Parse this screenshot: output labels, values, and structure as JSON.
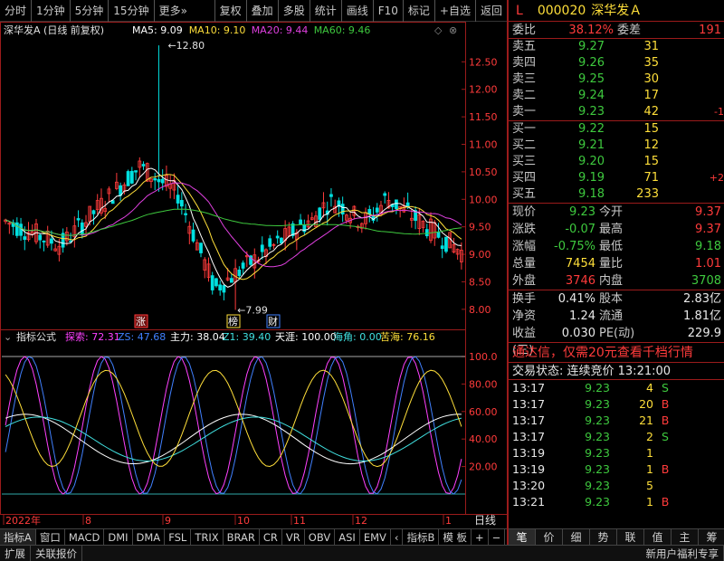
{
  "toolbar": {
    "left_items": [
      "分时",
      "1分钟",
      "5分钟",
      "15分钟",
      "更多»"
    ],
    "right_items": [
      "复权",
      "叠加",
      "多股",
      "统计",
      "画线",
      "F10",
      "标记",
      "+自选",
      "返回"
    ]
  },
  "chart": {
    "title": "深华发A (日线 前复权)",
    "ma": [
      {
        "label": "MA5: 9.09",
        "color": "#ffffff"
      },
      {
        "label": "MA10: 9.10",
        "color": "#ffdf3a"
      },
      {
        "label": "MA20: 9.44",
        "color": "#e040e0"
      },
      {
        "label": "MA60: 9.46",
        "color": "#3ec93e"
      }
    ],
    "price_axis": [
      "12.50",
      "12.00",
      "11.50",
      "11.00",
      "10.50",
      "10.00",
      "9.50",
      "9.00",
      "8.50",
      "8.00"
    ],
    "high_mark": "12.80",
    "low_mark": "7.99",
    "event_markers": [
      "涨",
      "榜",
      "财"
    ],
    "indicator": {
      "name": "指标公式",
      "values": [
        {
          "label": "探索: 72.31",
          "color": "#ff40ff"
        },
        {
          "label": "ZS: 47.68",
          "color": "#4080ff"
        },
        {
          "label": "主力: 38.04",
          "color": "#ffffff"
        },
        {
          "label": "Z1: 39.40",
          "color": "#40e0e0"
        },
        {
          "label": "天涯: 100.00",
          "color": "#ffffff"
        },
        {
          "label": "海角: 0.00",
          "color": "#40e0e0"
        },
        {
          "label": "苦海: 76.16",
          "color": "#ffdf3a"
        }
      ],
      "axis": [
        "100.0",
        "80.00",
        "60.00",
        "40.00",
        "20.00"
      ]
    },
    "date_axis": [
      "2022年",
      "8",
      "9",
      "10",
      "11",
      "12",
      "1"
    ],
    "period": "日线"
  },
  "bottom_tabs": [
    "指标A",
    "窗口",
    "MACD",
    "DMI",
    "DMA",
    "FSL",
    "TRIX",
    "BRAR",
    "CR",
    "VR",
    "OBV",
    "ASI",
    "EMV",
    "‹",
    "指标B",
    "模 板",
    "+",
    "−"
  ],
  "statusbar": {
    "left": [
      "扩展",
      "关联报价"
    ],
    "promo": "新用户福利专享"
  },
  "panel": {
    "marker": "L",
    "code": "000020",
    "name": "深华发Ａ",
    "weibi_label": "委比",
    "weibi": "38.12%",
    "weicha_label": "委差",
    "weicha": "191",
    "sells": [
      {
        "label": "卖五",
        "price": "9.27",
        "vol": "31",
        "chg": ""
      },
      {
        "label": "卖四",
        "price": "9.26",
        "vol": "35",
        "chg": ""
      },
      {
        "label": "卖三",
        "price": "9.25",
        "vol": "30",
        "chg": ""
      },
      {
        "label": "卖二",
        "price": "9.24",
        "vol": "17",
        "chg": ""
      },
      {
        "label": "卖一",
        "price": "9.23",
        "vol": "42",
        "chg": "-1"
      }
    ],
    "buys": [
      {
        "label": "买一",
        "price": "9.22",
        "vol": "15",
        "chg": ""
      },
      {
        "label": "买二",
        "price": "9.21",
        "vol": "12",
        "chg": ""
      },
      {
        "label": "买三",
        "price": "9.20",
        "vol": "15",
        "chg": ""
      },
      {
        "label": "买四",
        "price": "9.19",
        "vol": "71",
        "chg": "+2"
      },
      {
        "label": "买五",
        "price": "9.18",
        "vol": "233",
        "chg": ""
      }
    ],
    "quote": [
      {
        "k1": "现价",
        "v1": "9.23",
        "c1": "green",
        "k2": "今开",
        "v2": "9.37",
        "c2": "red"
      },
      {
        "k1": "涨跌",
        "v1": "-0.07",
        "c1": "green",
        "k2": "最高",
        "v2": "9.37",
        "c2": "red"
      },
      {
        "k1": "涨幅",
        "v1": "-0.75%",
        "c1": "green",
        "k2": "最低",
        "v2": "9.18",
        "c2": "green"
      },
      {
        "k1": "总量",
        "v1": "7454",
        "c1": "yellow",
        "k2": "量比",
        "v2": "1.01",
        "c2": "red"
      },
      {
        "k1": "外盘",
        "v1": "3746",
        "c1": "red",
        "k2": "内盘",
        "v2": "3708",
        "c2": "green"
      }
    ],
    "fundamentals": [
      {
        "k1": "换手",
        "v1": "0.41%",
        "k2": "股本",
        "v2": "2.83亿"
      },
      {
        "k1": "净资",
        "v1": "1.24",
        "k2": "流通",
        "v2": "1.81亿"
      },
      {
        "k1": "收益(三)",
        "v1": "0.030",
        "k2": "PE(动)",
        "v2": "229.9"
      }
    ],
    "promo": "通达信，仅需20元查看千档行情",
    "trade_status": "交易状态: 连续竞价  13:21:00",
    "ticks": [
      {
        "time": "13:17",
        "price": "9.23",
        "vol": "4",
        "bs": "S"
      },
      {
        "time": "13:17",
        "price": "9.23",
        "vol": "20",
        "bs": "B"
      },
      {
        "time": "13:17",
        "price": "9.23",
        "vol": "21",
        "bs": "B"
      },
      {
        "time": "13:17",
        "price": "9.23",
        "vol": "2",
        "bs": "S"
      },
      {
        "time": "13:19",
        "price": "9.23",
        "vol": "1",
        "bs": ""
      },
      {
        "time": "13:19",
        "price": "9.23",
        "vol": "1",
        "bs": "B"
      },
      {
        "time": "13:20",
        "price": "9.23",
        "vol": "5",
        "bs": ""
      },
      {
        "time": "13:21",
        "price": "9.23",
        "vol": "1",
        "bs": "B"
      }
    ],
    "tabs": [
      "笔",
      "价",
      "细",
      "势",
      "联",
      "值",
      "主",
      "筹"
    ]
  }
}
